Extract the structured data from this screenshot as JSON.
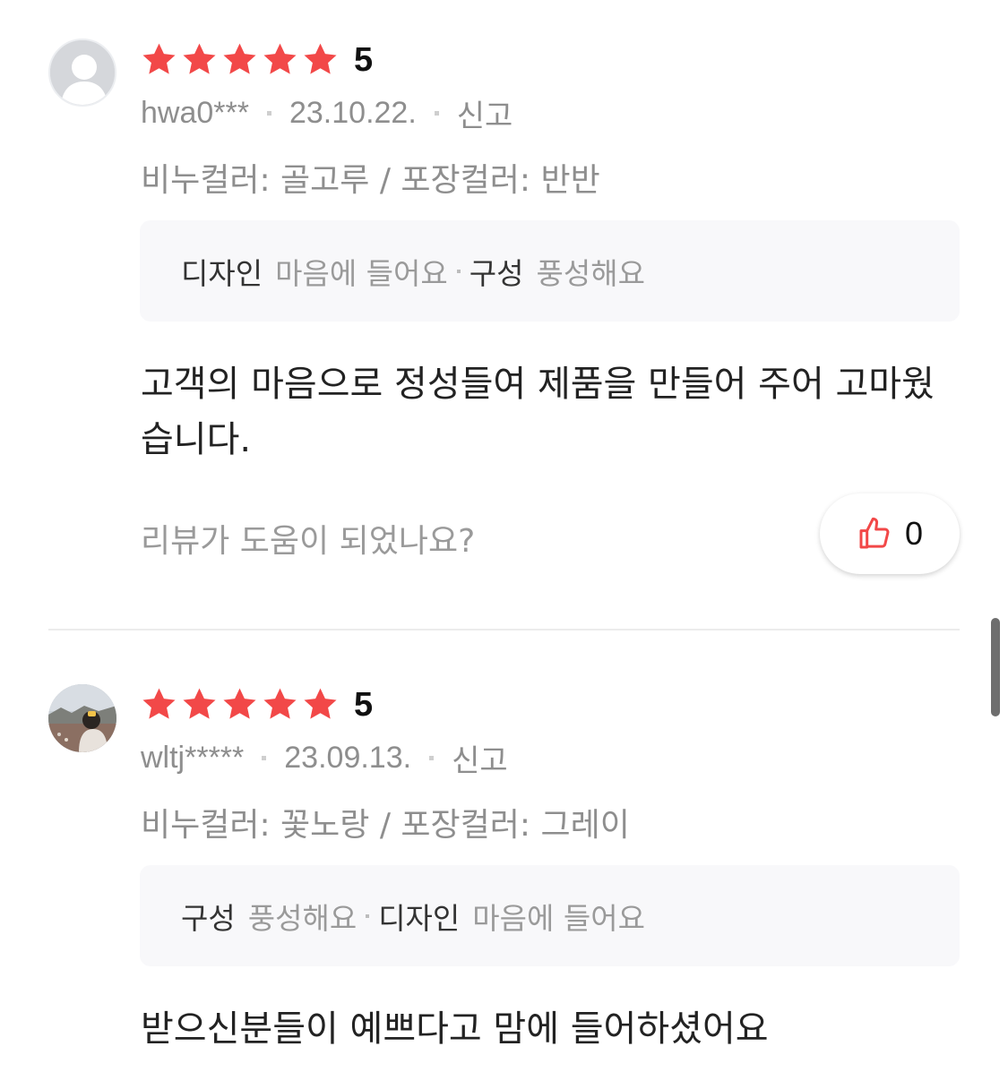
{
  "reviews": [
    {
      "rating": "5",
      "user": "hwa0***",
      "date": "23.10.22.",
      "report_label": "신고",
      "option": "비누컬러: 골고루 / 포장컬러: 반반",
      "tags": [
        {
          "key": "디자인",
          "value": "마음에 들어요"
        },
        {
          "key": "구성",
          "value": "풍성해요"
        }
      ],
      "content": "고객의 마음으로 정성들여 제품을 만들어 주어 고마웠습니다.",
      "helpful_question": "리뷰가 도움이 되었나요?",
      "likes": "0",
      "avatar": "default-person-icon"
    },
    {
      "rating": "5",
      "user": "wltj*****",
      "date": "23.09.13.",
      "report_label": "신고",
      "option": "비누컬러: 꽃노랑 / 포장컬러: 그레이",
      "tags": [
        {
          "key": "구성",
          "value": "풍성해요"
        },
        {
          "key": "디자인",
          "value": "마음에 들어요"
        }
      ],
      "content": "받으신분들이 예쁘다고 맘에 들어하셨어요",
      "avatar": "user-photo"
    }
  ],
  "colors": {
    "star": "#f24848",
    "thumb": "#f24848",
    "muted_text": "#8e8e8e",
    "tag_bg": "#f8f8fa"
  }
}
